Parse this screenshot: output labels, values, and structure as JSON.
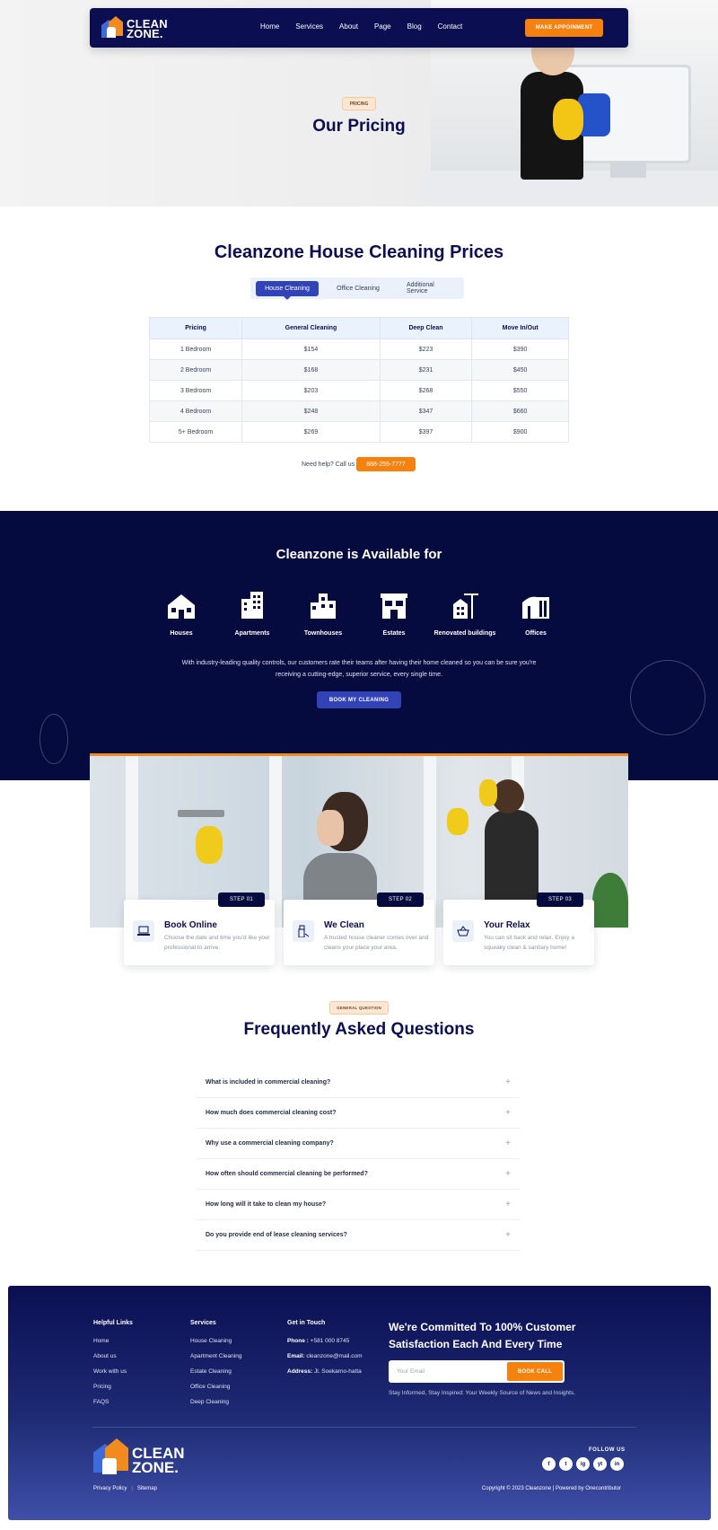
{
  "brand": {
    "name_line1": "CLEAN",
    "name_line2": "ZONE."
  },
  "nav": {
    "links": [
      "Home",
      "Services",
      "About",
      "Page",
      "Blog",
      "Contact"
    ],
    "cta": "MAKE APPOINMENT"
  },
  "hero": {
    "tag": "PRICING",
    "title": "Our Pricing"
  },
  "pricing": {
    "title": "Cleanzone House Cleaning Prices",
    "tabs": [
      "House Cleaning",
      "Office Cleaning",
      "Additional Service"
    ],
    "active_tab": "House Cleaning",
    "table": {
      "headers": [
        "Pricing",
        "General Cleaning",
        "Deep Clean",
        "Move In/Out"
      ],
      "rows": [
        [
          "1 Bedroom",
          "$154",
          "$223",
          "$390"
        ],
        [
          "2 Bedroom",
          "$168",
          "$231",
          "$450"
        ],
        [
          "3 Bedroom",
          "$203",
          "$268",
          "$550"
        ],
        [
          "4 Bedroom",
          "$248",
          "$347",
          "$660"
        ],
        [
          "5+ Bedroom",
          "$269",
          "$397",
          "$900"
        ]
      ]
    },
    "help_text": "Need help? Call us",
    "phone": "888-255-7777"
  },
  "available": {
    "title": "Cleanzone is Available for",
    "items": [
      "Houses",
      "Apartments",
      "Townhouses",
      "Estates",
      "Renovated buildings",
      "Offices"
    ],
    "description": "With industry-leading quality controls, our customers rate their teams after having their home cleaned so you can be sure you're receiving a cutting-edge, superior service, every single time.",
    "cta": "BOOK MY CLEANING"
  },
  "steps": [
    {
      "badge": "STEP 01",
      "title": "Book Online",
      "desc": "Choose the date and time you'd like your professional to arrive.",
      "icon": "laptop-icon"
    },
    {
      "badge": "STEP 02",
      "title": "We Clean",
      "desc": "A trusted house cleaner comes over and cleans your place your area.",
      "icon": "cleaning-spray-icon"
    },
    {
      "badge": "STEP 03",
      "title": "Your Relax",
      "desc": "You can sit back and relax. Enjoy a squeaky clean & sanitary home!",
      "icon": "basket-icon"
    }
  ],
  "faq": {
    "tag": "GENERAL QUESTION",
    "title": "Frequently Asked Questions",
    "questions": [
      "What is included in commercial cleaning?",
      "How much does commercial cleaning cost?",
      "Why use a commercial cleaning company?",
      "How often should commercial cleaning be performed?",
      "How long will it take to clean my house?",
      "Do you provide end of lease cleaning services?"
    ]
  },
  "footer": {
    "helpful": {
      "title": "Helpful Links",
      "links": [
        "Home",
        "About us",
        "Work with us",
        "Pricing",
        "FAQS"
      ]
    },
    "services": {
      "title": "Services",
      "links": [
        "House Cleaning",
        "Apartment Cleaning",
        "Estate Cleaning",
        "Office Cleaning",
        "Deep Cleaning"
      ]
    },
    "contact": {
      "title": "Get in Touch",
      "phone_label": "Phone :",
      "phone": "+581 000 8745",
      "email_label": "Email:",
      "email": "cleanzone@mail.com",
      "address_label": "Address:",
      "address": "Jl. Soekarno-hatta"
    },
    "cta_title": "We're Committed To 100% Customer Satisfaction Each And Every Time",
    "email_placeholder": "Your Email",
    "book_call": "BOOK CALL",
    "note": "Stay Informed, Stay Inspired: Your Weekly Source of News and Insights.",
    "follow_us": "FOLLOW US",
    "socials": [
      "f",
      "t",
      "ig",
      "yt",
      "in"
    ],
    "legal": [
      "Privacy Policy",
      "Sitemap"
    ],
    "copyright": "Copyright © 2023 Cleanzone | Powered by Onecontributor"
  },
  "colors": {
    "navy": "#0b0f52",
    "orange": "#f5820e",
    "accent_blue": "#3243b8"
  }
}
